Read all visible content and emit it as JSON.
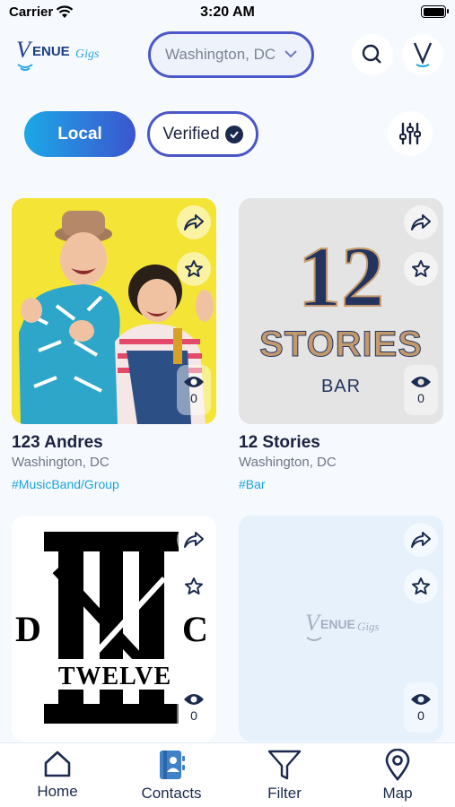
{
  "status_bar": {
    "carrier": "Carrier",
    "time": "3:20 AM"
  },
  "header": {
    "logo_text": "VENUEGIGS",
    "location": "Washington, DC"
  },
  "filters": {
    "local_label": "Local",
    "verified_label": "Verified"
  },
  "cards": [
    {
      "title": "123 Andres",
      "location": "Washington, DC",
      "tag": "#MusicBand/Group",
      "views": "0"
    },
    {
      "title": "12 Stories",
      "location": "Washington, DC",
      "tag": "#Bar",
      "views": "0",
      "image_text": {
        "number": "12",
        "word": "STORIES",
        "sub": "BAR"
      }
    },
    {
      "views": "0",
      "image_text": {
        "top": "XII",
        "left": "D",
        "right": "C",
        "word": "TWELVE"
      }
    },
    {
      "views": "0",
      "image_text": {
        "logo": "VENUEGIGS"
      }
    }
  ],
  "bottom_nav": [
    {
      "label": "Home",
      "icon": "home-icon"
    },
    {
      "label": "Contacts",
      "icon": "contacts-icon"
    },
    {
      "label": "Filter",
      "icon": "filter-icon"
    },
    {
      "label": "Map",
      "icon": "map-pin-icon"
    }
  ],
  "colors": {
    "accent": "#4b57c8",
    "tag": "#1aa3dd",
    "gradient_start": "#1ca8e6",
    "gradient_end": "#3b55cf",
    "card4_bg": "#e6f1fb"
  }
}
